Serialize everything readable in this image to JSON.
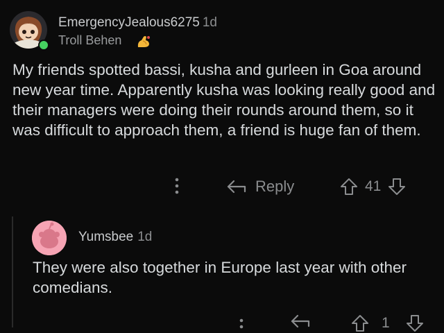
{
  "comment": {
    "username": "EmergencyJealous6275",
    "age": "1d",
    "flair": "Troll Behen",
    "flair_icon": "flexed-arm-emoji",
    "body": "My friends spotted bassi, kusha and gurleen in Goa around new year time. Apparently kusha was looking really good and their managers were doing their rounds around them, so it was difficult to approach them, a friend is huge fan of them.",
    "reply_label": "Reply",
    "score": "41"
  },
  "reply": {
    "username": "Yumsbee",
    "age": "1d",
    "body": "They were also together in Europe last year with other comedians.",
    "score": "1"
  },
  "colors": {
    "background": "#0b0b0b",
    "text": "#d7dadc",
    "muted": "#8b8d8f",
    "online": "#46d160",
    "avatar_pink": "#f6a4b4"
  }
}
